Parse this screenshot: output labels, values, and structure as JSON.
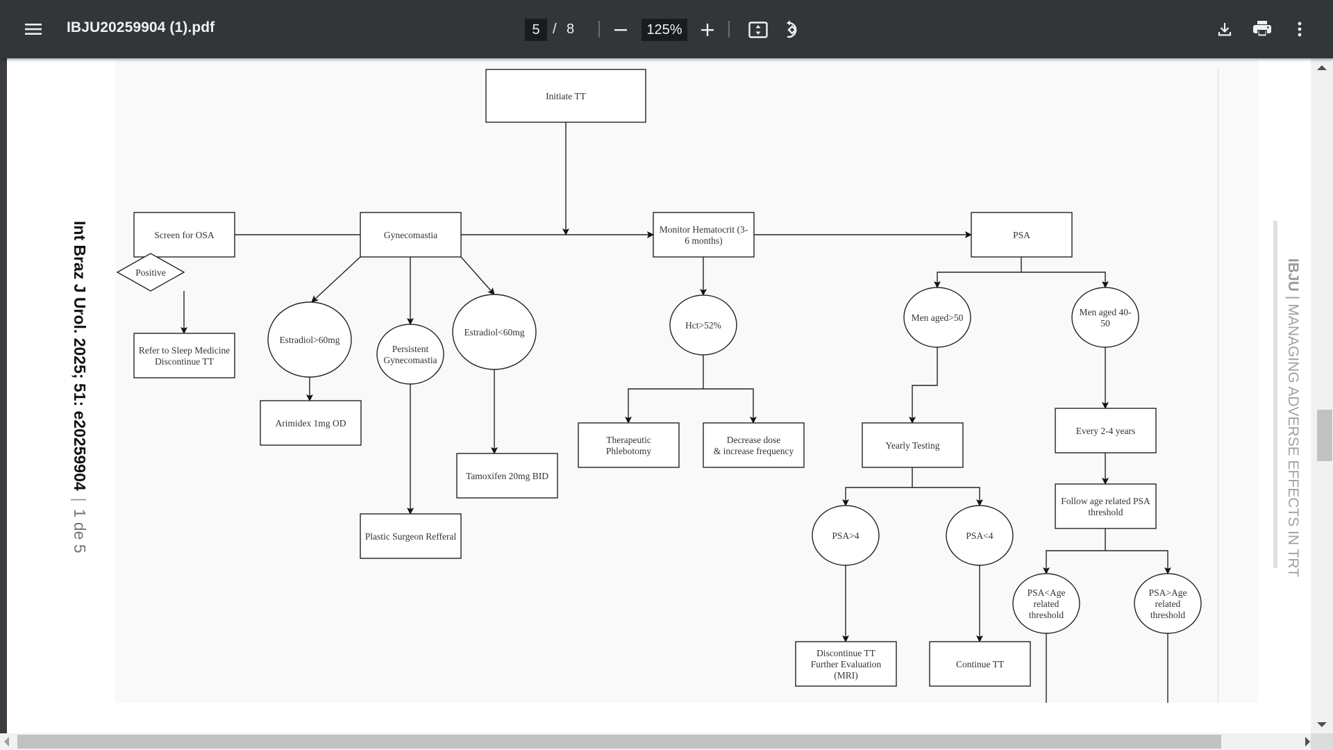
{
  "toolbar": {
    "title": "IBJU20259904 (1).pdf",
    "page_current": "5",
    "page_separator": "/",
    "page_total": "8",
    "zoom_level": "125%",
    "icons": {
      "menu": "hamburger-menu-icon",
      "zoom_out": "minus-icon",
      "zoom_in": "plus-icon",
      "fit": "fit-to-page-icon",
      "rotate": "rotate-counterclockwise-icon",
      "download": "download-icon",
      "print": "print-icon",
      "more": "more-vertical-icon"
    }
  },
  "page": {
    "journal_ref": "Int Braz J Urol. 2025; 51: e20259904",
    "separator": "|",
    "page_label": "1 de 5",
    "running_title_bold": "IBJU",
    "running_title_sep": "|",
    "running_title": "MANAGING ADVERSE EFFECTS IN TRT"
  },
  "flowchart": {
    "nodes": [
      {
        "id": "initiate",
        "shape": "rect",
        "lines": [
          "Initiate TT"
        ]
      },
      {
        "id": "osa",
        "shape": "rect",
        "lines": [
          "Screen for OSA"
        ]
      },
      {
        "id": "positive",
        "shape": "diamond",
        "lines": [
          "Positive"
        ]
      },
      {
        "id": "sleep",
        "shape": "rect",
        "lines": [
          "Refer to Sleep Medicine",
          "Discontinue TT"
        ]
      },
      {
        "id": "gyneco",
        "shape": "rect",
        "lines": [
          "Gynecomastia"
        ]
      },
      {
        "id": "e2high",
        "shape": "ellipse",
        "lines": [
          "Estradiol>60mg"
        ]
      },
      {
        "id": "persist",
        "shape": "ellipse",
        "lines": [
          "Persistent",
          "Gynecomastia"
        ]
      },
      {
        "id": "e2low",
        "shape": "ellipse",
        "lines": [
          "Estradiol<60mg"
        ]
      },
      {
        "id": "arimidex",
        "shape": "rect",
        "lines": [
          "Arimidex 1mg OD"
        ]
      },
      {
        "id": "tamox",
        "shape": "rect",
        "lines": [
          "Tamoxifen 20mg BID"
        ]
      },
      {
        "id": "plastic",
        "shape": "rect",
        "lines": [
          "Plastic Surgeon Refferal"
        ]
      },
      {
        "id": "hct",
        "shape": "rect",
        "lines": [
          "Monitor Hematocrit (3-",
          "6 months)"
        ]
      },
      {
        "id": "hct52",
        "shape": "ellipse",
        "lines": [
          "Hct>52%"
        ]
      },
      {
        "id": "phleb",
        "shape": "rect",
        "lines": [
          "Therapeutic",
          "Phlebotomy"
        ]
      },
      {
        "id": "dose",
        "shape": "rect",
        "lines": [
          "Decrease dose",
          "& increase frequency"
        ]
      },
      {
        "id": "psa",
        "shape": "rect",
        "lines": [
          "PSA"
        ]
      },
      {
        "id": "over50",
        "shape": "ellipse",
        "lines": [
          "Men aged>50"
        ]
      },
      {
        "id": "age4050",
        "shape": "ellipse",
        "lines": [
          "Men aged 40-",
          "50"
        ]
      },
      {
        "id": "yearly",
        "shape": "rect",
        "lines": [
          "Yearly Testing"
        ]
      },
      {
        "id": "every24",
        "shape": "rect",
        "lines": [
          "Every 2-4 years"
        ]
      },
      {
        "id": "follow",
        "shape": "rect",
        "lines": [
          "Follow age related PSA",
          "threshold"
        ]
      },
      {
        "id": "psagt4",
        "shape": "ellipse",
        "lines": [
          "PSA>4"
        ]
      },
      {
        "id": "psalt4",
        "shape": "ellipse",
        "lines": [
          "PSA<4"
        ]
      },
      {
        "id": "ltage",
        "shape": "ellipse",
        "lines": [
          "PSA<Age",
          "related",
          "threshold"
        ]
      },
      {
        "id": "gtage",
        "shape": "ellipse",
        "lines": [
          "PSA>Age",
          "related",
          "threshold"
        ]
      },
      {
        "id": "disc",
        "shape": "rect",
        "lines": [
          "Discontinue TT",
          "Further Evaluation",
          "(MRI)"
        ]
      },
      {
        "id": "cont",
        "shape": "rect",
        "lines": [
          "Continue TT"
        ]
      }
    ],
    "edges": [
      [
        "initiate",
        "main-line"
      ],
      [
        "osa",
        "gyneco"
      ],
      [
        "gyneco",
        "hct"
      ],
      [
        "hct",
        "psa"
      ],
      [
        "osa",
        "positive"
      ],
      [
        "positive",
        "sleep"
      ],
      [
        "gyneco",
        "e2high"
      ],
      [
        "gyneco",
        "persist"
      ],
      [
        "gyneco",
        "e2low"
      ],
      [
        "e2high",
        "arimidex"
      ],
      [
        "persist",
        "plastic"
      ],
      [
        "e2low",
        "tamox"
      ],
      [
        "hct",
        "hct52"
      ],
      [
        "hct52",
        "phleb"
      ],
      [
        "hct52",
        "dose"
      ],
      [
        "psa",
        "over50"
      ],
      [
        "psa",
        "age4050"
      ],
      [
        "over50",
        "yearly"
      ],
      [
        "age4050",
        "every24"
      ],
      [
        "yearly",
        "psagt4"
      ],
      [
        "yearly",
        "psalt4"
      ],
      [
        "psagt4",
        "disc"
      ],
      [
        "psalt4",
        "cont"
      ],
      [
        "every24",
        "follow"
      ],
      [
        "follow",
        "ltage"
      ],
      [
        "follow",
        "gtage"
      ]
    ]
  }
}
